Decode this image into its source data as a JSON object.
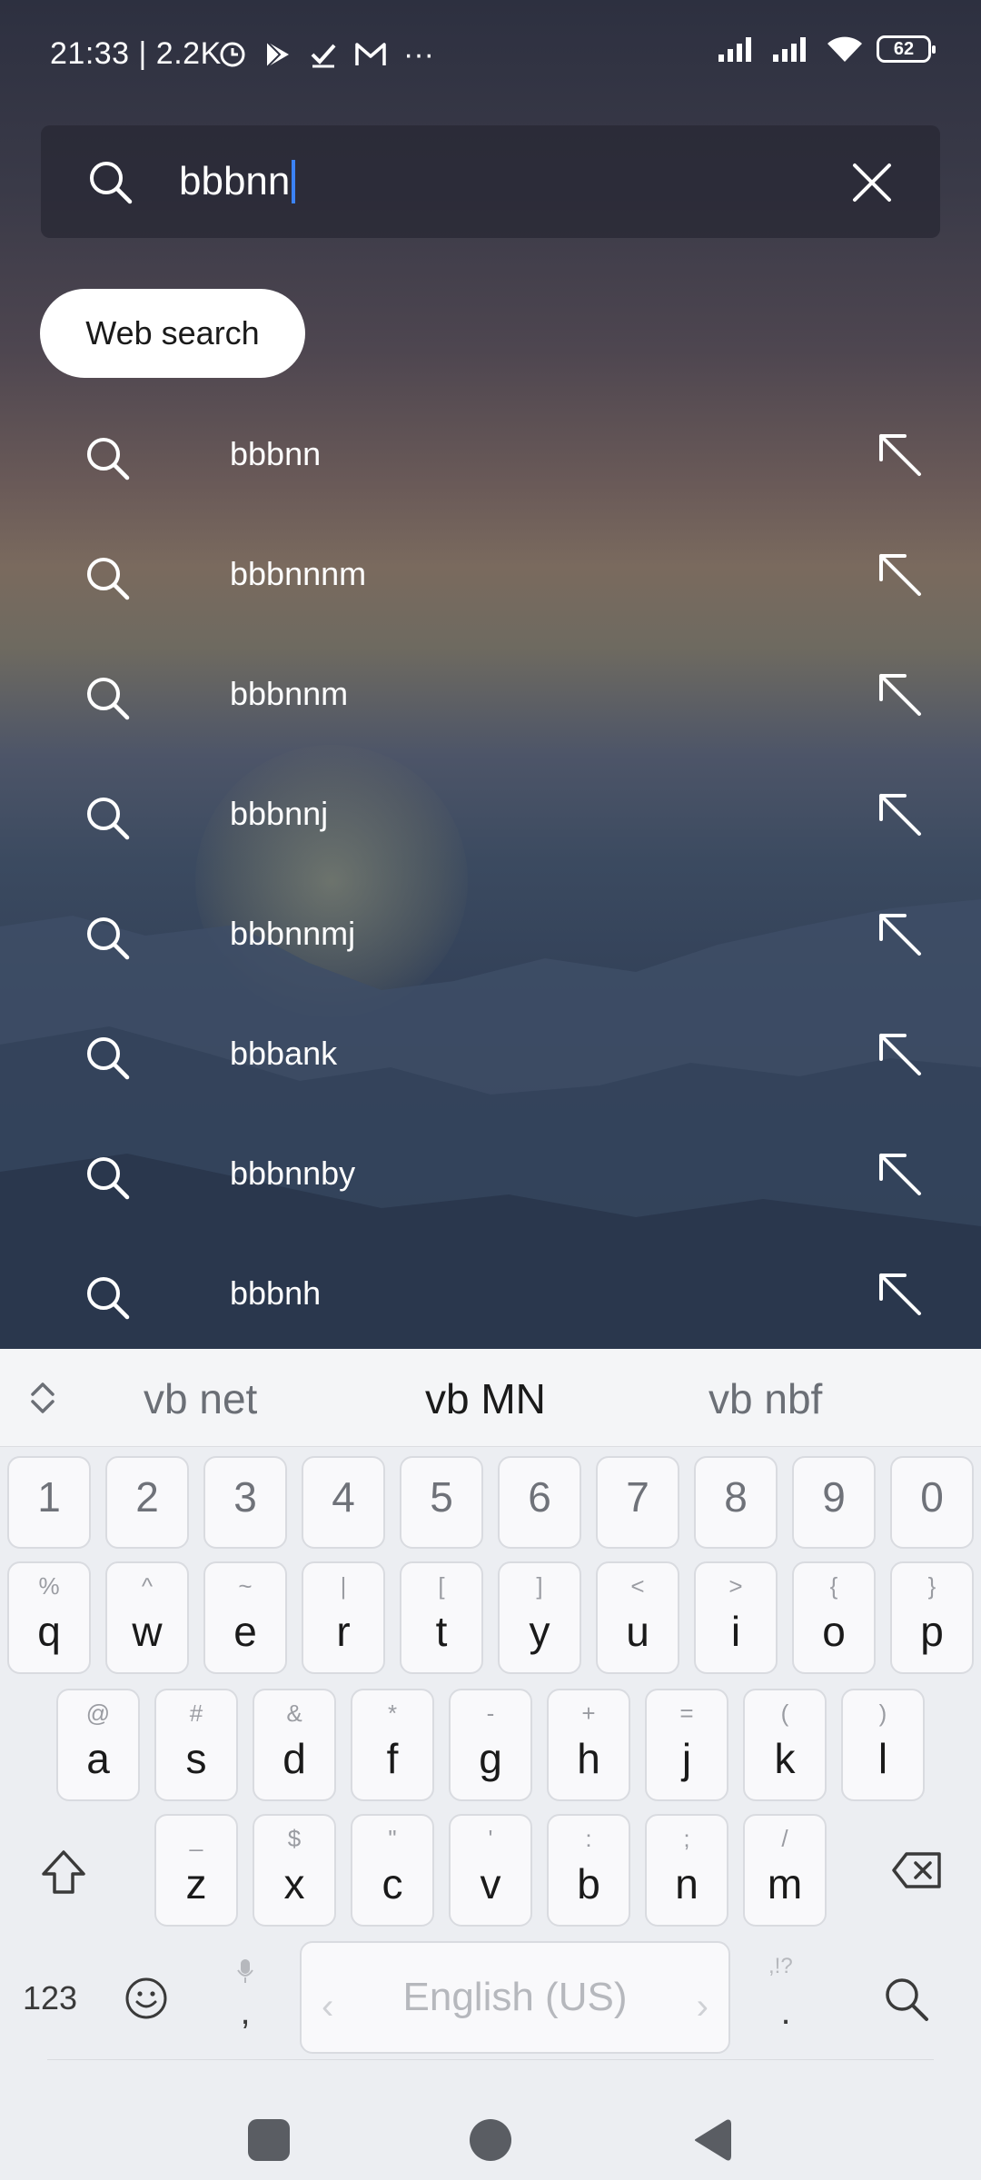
{
  "status_bar": {
    "time": "21:33 | 2.2K",
    "icons_left": [
      "clock-icon",
      "play-store-icon",
      "check-icon",
      "gmail-icon",
      "more-icon"
    ],
    "more": "···",
    "battery": "62"
  },
  "search": {
    "query": "bbbnn"
  },
  "web_search_label": "Web search",
  "suggestions": [
    {
      "text": "bbbnn"
    },
    {
      "text": "bbbnnnm"
    },
    {
      "text": "bbbnnm"
    },
    {
      "text": "bbbnnj"
    },
    {
      "text": "bbbnnmj"
    },
    {
      "text": "bbbank"
    },
    {
      "text": "bbbnnby"
    },
    {
      "text": "bbbnh"
    }
  ],
  "keyboard": {
    "predictions": [
      "vb net",
      "vb MN",
      "vb nbf"
    ],
    "numbers": [
      "1",
      "2",
      "3",
      "4",
      "5",
      "6",
      "7",
      "8",
      "9",
      "0"
    ],
    "row1": [
      {
        "k": "q",
        "s": "%"
      },
      {
        "k": "w",
        "s": "^"
      },
      {
        "k": "e",
        "s": "~"
      },
      {
        "k": "r",
        "s": "|"
      },
      {
        "k": "t",
        "s": "["
      },
      {
        "k": "y",
        "s": "]"
      },
      {
        "k": "u",
        "s": "<"
      },
      {
        "k": "i",
        "s": ">"
      },
      {
        "k": "o",
        "s": "{"
      },
      {
        "k": "p",
        "s": "}"
      }
    ],
    "row2": [
      {
        "k": "a",
        "s": "@"
      },
      {
        "k": "s",
        "s": "#"
      },
      {
        "k": "d",
        "s": "&"
      },
      {
        "k": "f",
        "s": "*"
      },
      {
        "k": "g",
        "s": "-"
      },
      {
        "k": "h",
        "s": "+"
      },
      {
        "k": "j",
        "s": "="
      },
      {
        "k": "k",
        "s": "("
      },
      {
        "k": "l",
        "s": ")"
      }
    ],
    "row3": [
      {
        "k": "z",
        "s": "_"
      },
      {
        "k": "x",
        "s": "$"
      },
      {
        "k": "c",
        "s": "\""
      },
      {
        "k": "v",
        "s": "'"
      },
      {
        "k": "b",
        "s": ":"
      },
      {
        "k": "n",
        "s": ";"
      },
      {
        "k": "m",
        "s": "/"
      }
    ],
    "symbols_label": "123",
    "comma": ",",
    "period": ".",
    "period_sup": ",!?",
    "space_label": "English (US)"
  }
}
